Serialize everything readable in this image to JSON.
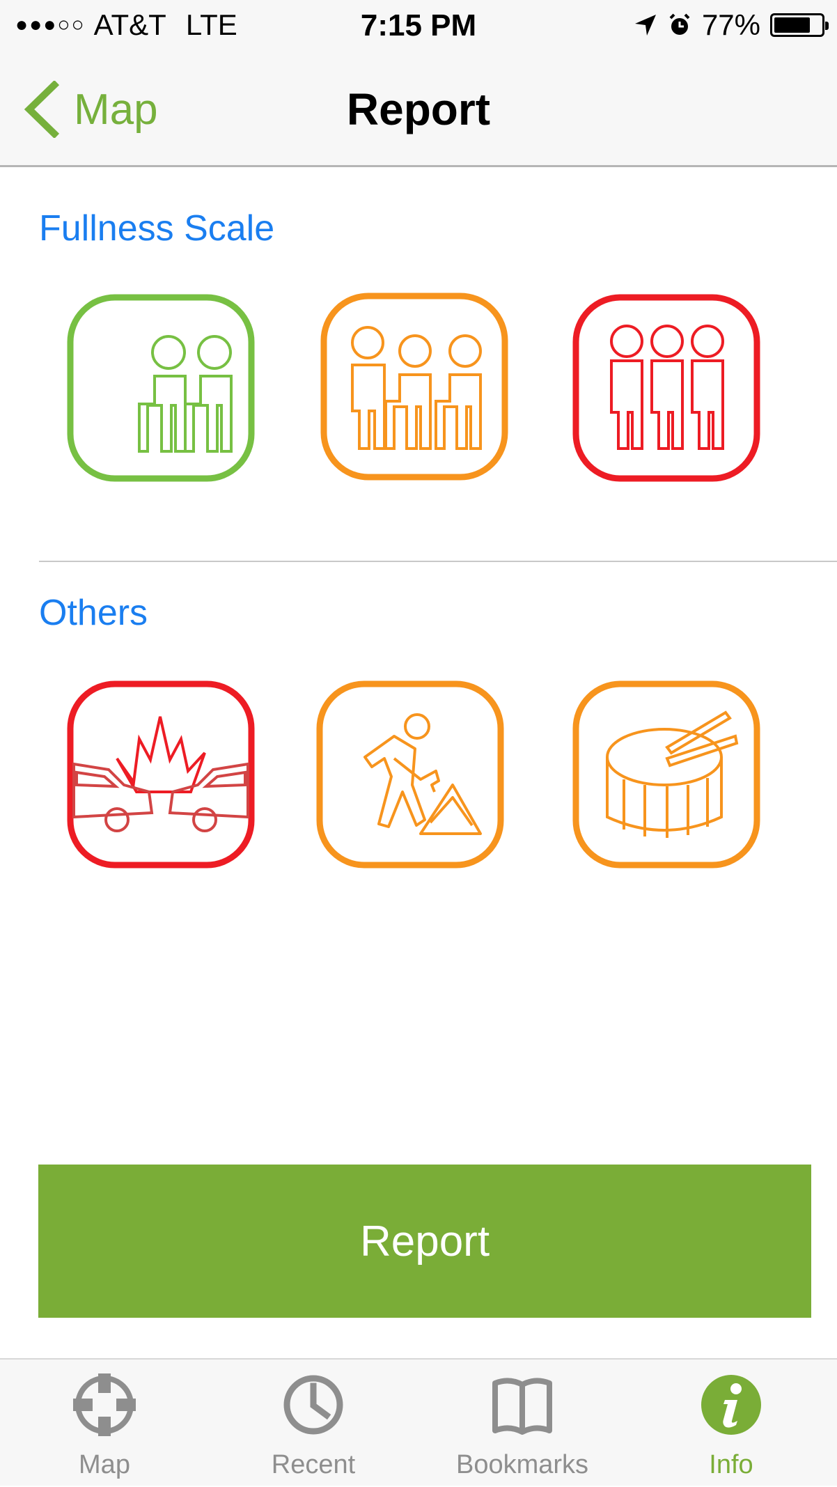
{
  "status_bar": {
    "signal": "●●●○○",
    "carrier": "AT&T",
    "network": "LTE",
    "time": "7:15 PM",
    "battery": "77%",
    "battery_level": 0.77
  },
  "nav": {
    "back_label": "Map",
    "title": "Report"
  },
  "sections": {
    "fullness": "Fullness Scale",
    "others": "Others"
  },
  "fullness_options": [
    {
      "icon": "two-passengers-icon",
      "color": "#77c043"
    },
    {
      "icon": "three-passengers-seated-icon",
      "color": "#f7941d"
    },
    {
      "icon": "three-passengers-standing-icon",
      "color": "#ed1c24"
    }
  ],
  "other_options": [
    {
      "icon": "car-crash-icon",
      "color": "#ed1c24"
    },
    {
      "icon": "road-work-icon",
      "color": "#f7941d"
    },
    {
      "icon": "drum-parade-icon",
      "color": "#f7941d"
    }
  ],
  "report_button": "Report",
  "tabs": [
    {
      "label": "Map",
      "icon": "crosshair-icon"
    },
    {
      "label": "Recent",
      "icon": "clock-icon"
    },
    {
      "label": "Bookmarks",
      "icon": "book-icon"
    },
    {
      "label": "Info",
      "icon": "info-icon",
      "active": true
    }
  ],
  "colors": {
    "accent_green": "#7aad37",
    "section_blue": "#1a7ef0",
    "tab_inactive": "#8e8e8e"
  }
}
